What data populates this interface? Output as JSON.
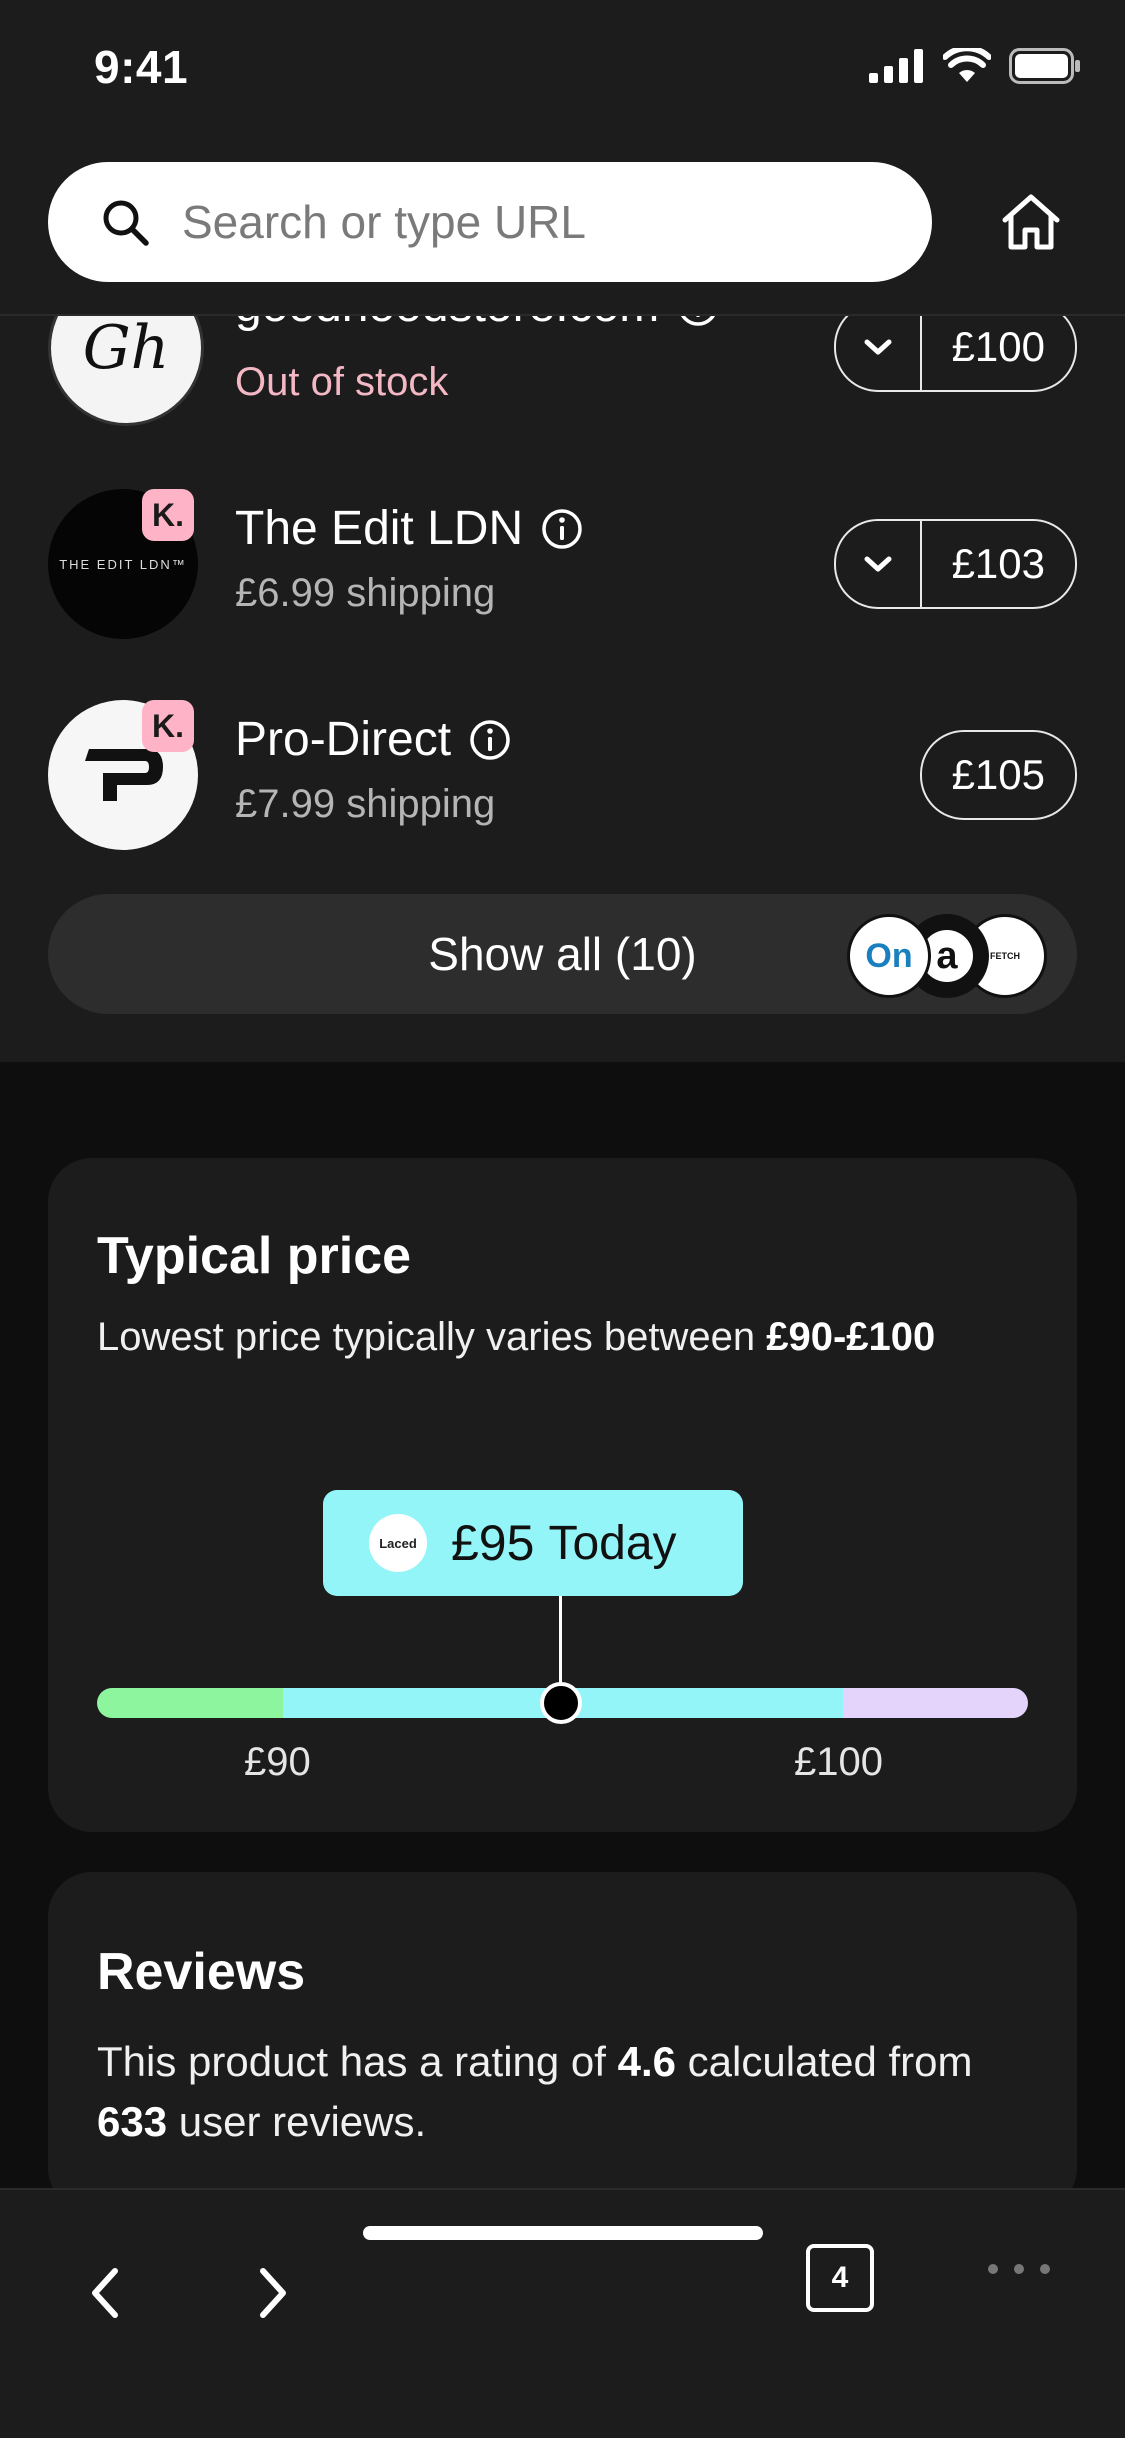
{
  "status": {
    "time": "9:41"
  },
  "search": {
    "placeholder": "Search or type URL"
  },
  "retailers": [
    {
      "name": "goodhoodstore.com",
      "sub": "Out of stock",
      "price": "£100",
      "has_dropdown": true,
      "logo_text": "Gh"
    },
    {
      "name": "The Edit LDN",
      "sub": "£6.99 shipping",
      "price": "£103",
      "has_dropdown": true,
      "logo_text": "THE EDIT LDN™"
    },
    {
      "name": "Pro-Direct",
      "sub": "£7.99 shipping",
      "price": "£105",
      "has_dropdown": false,
      "logo_text": "P"
    }
  ],
  "badge_letter": "K.",
  "show_all": {
    "label": "Show all (10)",
    "stacked_logos": [
      {
        "text": "On",
        "icon": "on-logo"
      },
      {
        "text": "a",
        "icon": "a-logo"
      },
      {
        "text": "FETCH",
        "icon": "farfetch-logo"
      }
    ]
  },
  "typical_price": {
    "title": "Typical price",
    "desc_prefix": "Lowest price typically varies between ",
    "desc_range": "£90-£100",
    "tooltip_logo": "Laced",
    "tooltip_price": "£95",
    "tooltip_label": "Today",
    "low_label": "£90",
    "high_label": "£100",
    "current_price": 95,
    "colors": {
      "low": "#8ef59f",
      "typical": "#94f5f8",
      "high": "#e4d4fb"
    }
  },
  "reviews": {
    "title": "Reviews",
    "text1": "This product has a rating of ",
    "rating": "4.6",
    "text2": " calculated from ",
    "count": "633",
    "text3": " user reviews."
  },
  "toolbar": {
    "tab_count": "4"
  }
}
